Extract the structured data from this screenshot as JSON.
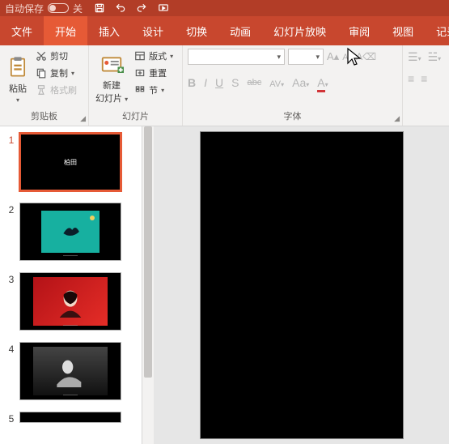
{
  "titlebar": {
    "autosave_label": "自动保存",
    "autosave_state": "关"
  },
  "qat": {
    "save": "save-icon",
    "undo": "undo-icon",
    "redo": "redo-icon",
    "slideshow": "slideshow-icon"
  },
  "tabs": {
    "file": "文件",
    "home": "开始",
    "insert": "插入",
    "design": "设计",
    "transitions": "切换",
    "animations": "动画",
    "slideshow": "幻灯片放映",
    "review": "审阅",
    "view": "视图",
    "record": "记录"
  },
  "ribbon": {
    "clipboard": {
      "title": "剪贴板",
      "paste": "粘贴",
      "cut": "剪切",
      "copy": "复制",
      "format_painter": "格式刷"
    },
    "slides": {
      "title": "幻灯片",
      "new_slide_line1": "新建",
      "new_slide_line2": "幻灯片",
      "layout": "版式",
      "reset": "重置",
      "section": "节"
    },
    "font": {
      "title": "字体",
      "font_name": "",
      "font_size": "",
      "bold": "B",
      "italic": "I",
      "underline": "U",
      "shadow": "S",
      "strike": "abc",
      "spacing": "AV",
      "case": "Aa",
      "color": "A"
    },
    "paragraph": {
      "bullets": "•",
      "numbering": "1."
    }
  },
  "thumbnails": {
    "items": [
      {
        "num": "1",
        "selected": true,
        "caption": "柏田"
      },
      {
        "num": "2",
        "selected": false,
        "caption": ""
      },
      {
        "num": "3",
        "selected": false,
        "caption": ""
      },
      {
        "num": "4",
        "selected": false,
        "caption": ""
      },
      {
        "num": "5",
        "selected": false,
        "caption": ""
      }
    ]
  }
}
